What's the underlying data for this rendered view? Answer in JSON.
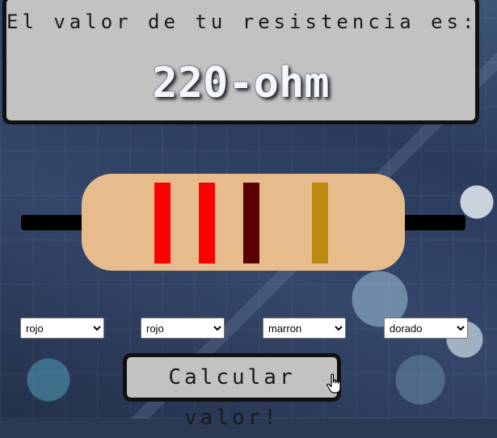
{
  "header": {
    "title": "El valor de tu resistencia es:",
    "result": "220-ohm"
  },
  "resistor": {
    "body_color": "#e6bc8c",
    "wire_color": "#000000",
    "bands": [
      {
        "name": "band-1",
        "color": "#ff0000"
      },
      {
        "name": "band-2",
        "color": "#ff0000"
      },
      {
        "name": "band-3",
        "color": "#5a0000"
      },
      {
        "name": "band-4",
        "color": "#bb8a10"
      }
    ]
  },
  "selects": [
    {
      "name": "band-1-select",
      "value": "rojo"
    },
    {
      "name": "band-2-select",
      "value": "rojo"
    },
    {
      "name": "multiplier-select",
      "value": "marron"
    },
    {
      "name": "tolerance-select",
      "value": "dorado"
    }
  ],
  "button": {
    "label": "Calcular valor!"
  },
  "cursor_icon": "hand-pointer-icon"
}
